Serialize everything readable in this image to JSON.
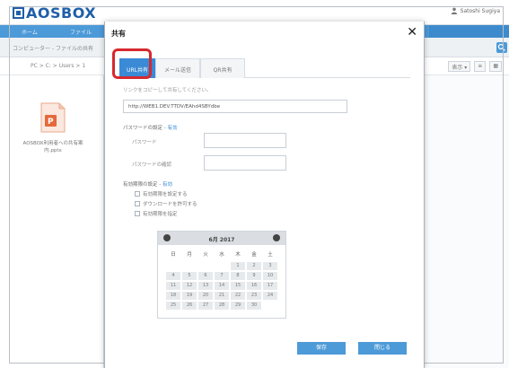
{
  "app": {
    "logo": "AOSBOX",
    "user_name": "Satoshi Sugiya"
  },
  "nav": {
    "items": [
      "ホーム",
      "ファイル"
    ]
  },
  "breadcrumb": {
    "text": "コンピューター - ファイルの共有"
  },
  "path": {
    "text": "PC > C: > Users > 1"
  },
  "toolbar": {
    "view_label": "表示 ▾",
    "list_label": "≡",
    "grid_label": "▦"
  },
  "file": {
    "name": "AOSBOX利用者への共有案内.pptx"
  },
  "modal": {
    "title": "共有",
    "close_symbol": "✕",
    "tabs": [
      "URL共有",
      "メール送信",
      "QR共有"
    ],
    "instruction": "リンクをコピーして共有してください。",
    "url": "http://WEB1.DEV.TTDV/EAhd4SBYdbe",
    "password_section": "パスワードの設定",
    "password_section_accent": "有効",
    "password_label": "パスワード",
    "password_confirm_label": "パスワードの確認",
    "expiry_section": "有効期限の設定",
    "expiry_section_accent": "有効",
    "options": [
      "有効期限を設定する",
      "ダウンロードを許可する",
      "有効期限を指定"
    ],
    "ok_label": "保存",
    "cancel_label": "閉じる"
  },
  "calendar": {
    "month": "6月 2017",
    "weekdays": [
      "日",
      "月",
      "火",
      "水",
      "木",
      "金",
      "土"
    ],
    "days": [
      "",
      "",
      "",
      "",
      "1",
      "2",
      "3",
      "4",
      "5",
      "6",
      "7",
      "8",
      "9",
      "10",
      "11",
      "12",
      "13",
      "14",
      "15",
      "16",
      "17",
      "18",
      "19",
      "20",
      "21",
      "22",
      "23",
      "24",
      "25",
      "26",
      "27",
      "28",
      "29",
      "30",
      ""
    ]
  },
  "colors": {
    "brand": "#1f5fa8",
    "accent": "#3a8ad6",
    "highlight": "#d7282f",
    "ppt": "#e46a3b"
  }
}
